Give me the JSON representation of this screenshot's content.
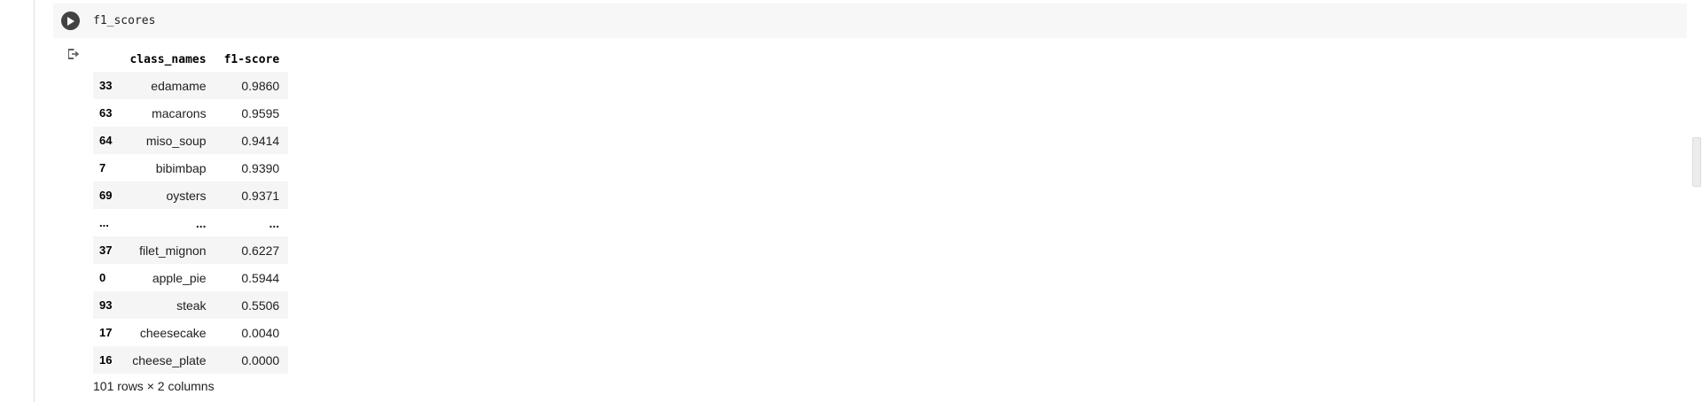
{
  "code_cell": {
    "code": "f1_scores",
    "run_icon": "play-icon"
  },
  "output": {
    "output_icon": "output-redirect-icon",
    "table": {
      "columns": [
        "",
        "class_names",
        "f1-score"
      ],
      "rows": [
        {
          "index": "33",
          "class_names": "edamame",
          "f1": "0.9860"
        },
        {
          "index": "63",
          "class_names": "macarons",
          "f1": "0.9595"
        },
        {
          "index": "64",
          "class_names": "miso_soup",
          "f1": "0.9414"
        },
        {
          "index": "7",
          "class_names": "bibimbap",
          "f1": "0.9390"
        },
        {
          "index": "69",
          "class_names": "oysters",
          "f1": "0.9371"
        },
        {
          "index": "...",
          "class_names": "...",
          "f1": "..."
        },
        {
          "index": "37",
          "class_names": "filet_mignon",
          "f1": "0.6227"
        },
        {
          "index": "0",
          "class_names": "apple_pie",
          "f1": "0.5944"
        },
        {
          "index": "93",
          "class_names": "steak",
          "f1": "0.5506"
        },
        {
          "index": "17",
          "class_names": "cheesecake",
          "f1": "0.0040"
        },
        {
          "index": "16",
          "class_names": "cheese_plate",
          "f1": "0.0000"
        }
      ]
    },
    "shape_text": "101 rows × 2 columns"
  }
}
